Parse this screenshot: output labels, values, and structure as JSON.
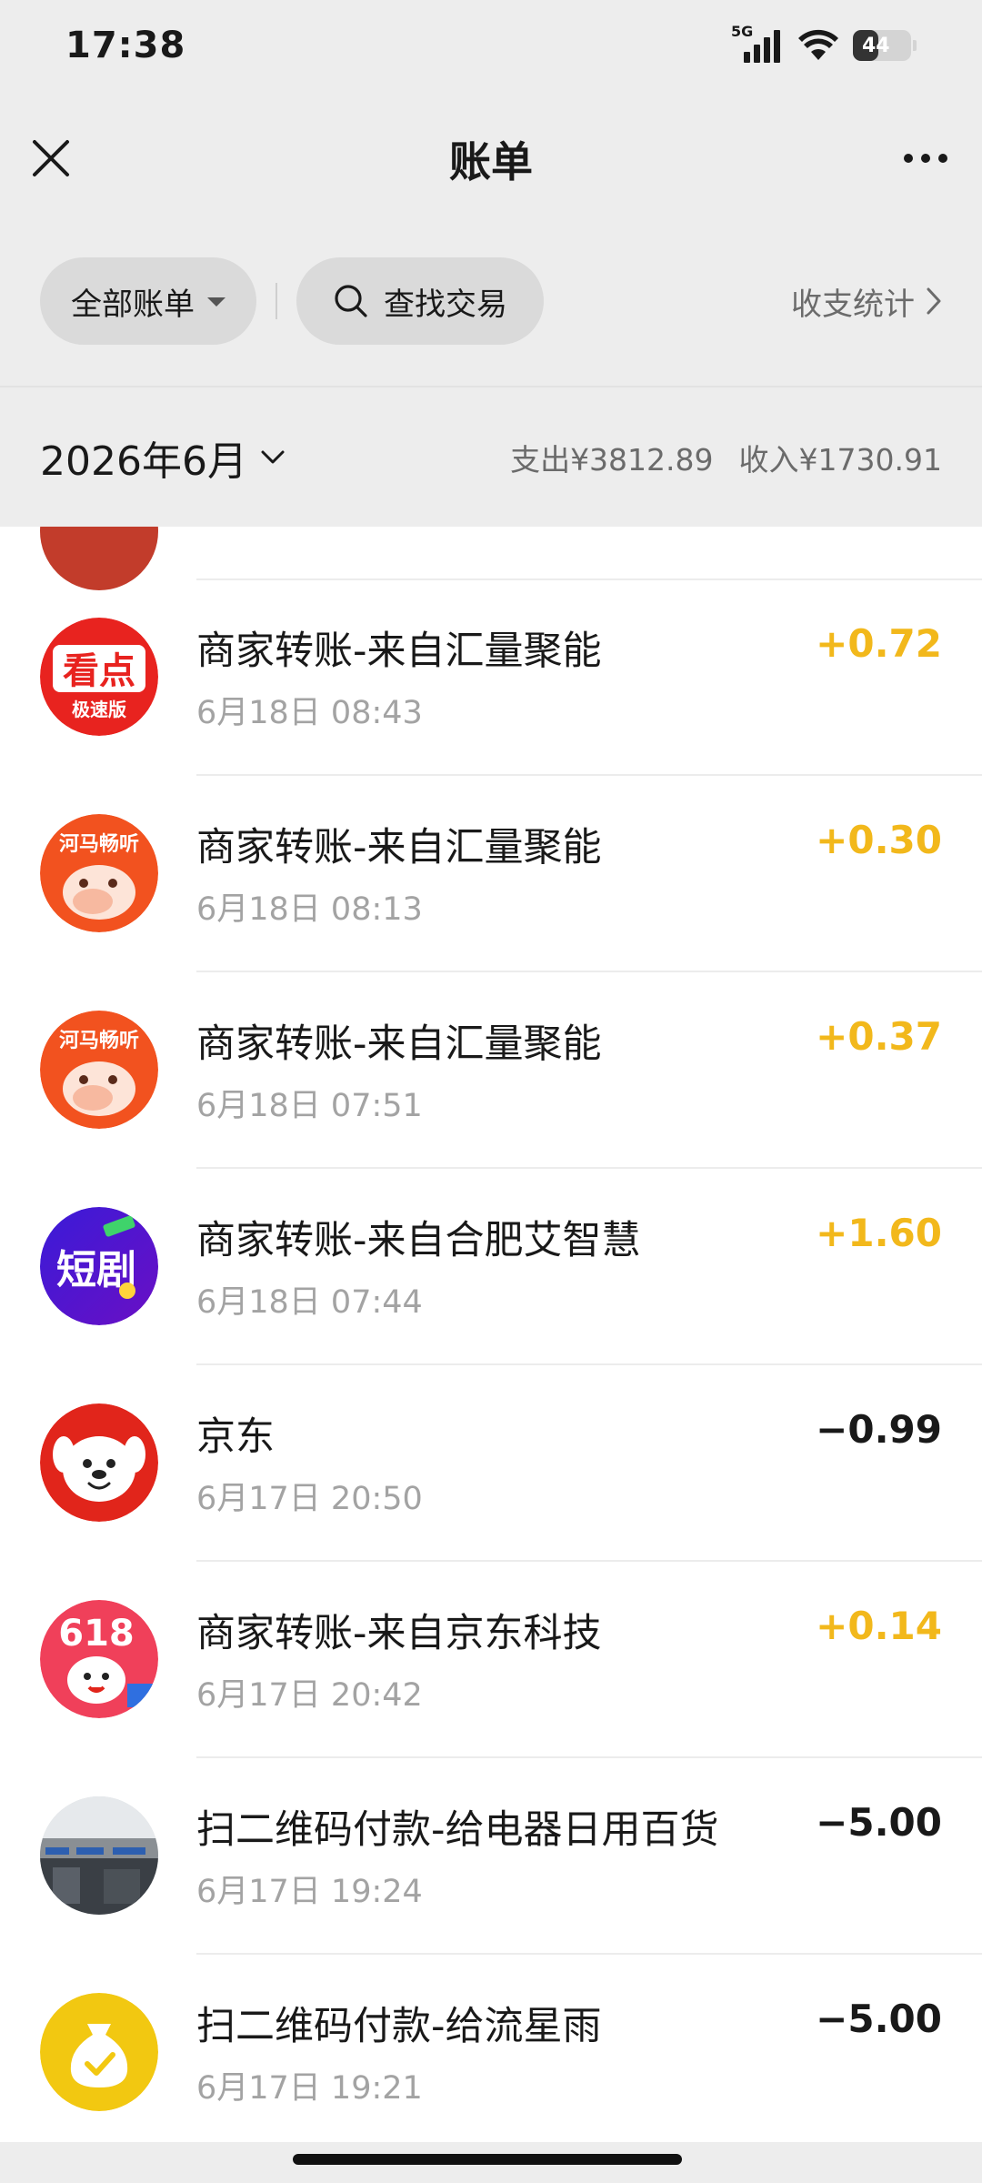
{
  "status_bar": {
    "time": "17:38",
    "network": "5G",
    "battery": "44",
    "battery_level": 0.44
  },
  "header": {
    "title": "账单",
    "close_icon": "close-icon",
    "more_icon": "more-icon"
  },
  "filters": {
    "all_bills": "全部账单",
    "search_label": "查找交易",
    "stats_label": "收支统计"
  },
  "month_bar": {
    "month": "2026年6月",
    "expense": "支出¥3812.89",
    "income": "收入¥1730.91"
  },
  "transactions": [
    {
      "title": "商家转账-来自汇量聚能",
      "time": "6月18日 08:43",
      "amount": "+0.72",
      "type": "income",
      "icon": "kandian-app-icon"
    },
    {
      "title": "商家转账-来自汇量聚能",
      "time": "6月18日 08:13",
      "amount": "+0.30",
      "type": "income",
      "icon": "hema-changting-app-icon"
    },
    {
      "title": "商家转账-来自汇量聚能",
      "time": "6月18日 07:51",
      "amount": "+0.37",
      "type": "income",
      "icon": "hema-changting-app-icon"
    },
    {
      "title": "商家转账-来自合肥艾智慧",
      "time": "6月18日 07:44",
      "amount": "+1.60",
      "type": "income",
      "icon": "duanju-app-icon"
    },
    {
      "title": "京东",
      "time": "6月17日 20:50",
      "amount": "−0.99",
      "type": "expense",
      "icon": "jd-dog-icon"
    },
    {
      "title": "商家转账-来自京东科技",
      "time": "6月17日 20:42",
      "amount": "+0.14",
      "type": "income",
      "icon": "jd-618-icon"
    },
    {
      "title": "扫二维码付款-给电器日用百货",
      "time": "6月17日 19:24",
      "amount": "−5.00",
      "type": "expense",
      "icon": "store-photo-avatar"
    },
    {
      "title": "扫二维码付款-给流星雨",
      "time": "6月17日 19:21",
      "amount": "−5.00",
      "type": "expense",
      "icon": "money-bag-icon"
    }
  ],
  "colors": {
    "income": "#f2b81b",
    "expense": "#191919",
    "background": "#ededed"
  }
}
